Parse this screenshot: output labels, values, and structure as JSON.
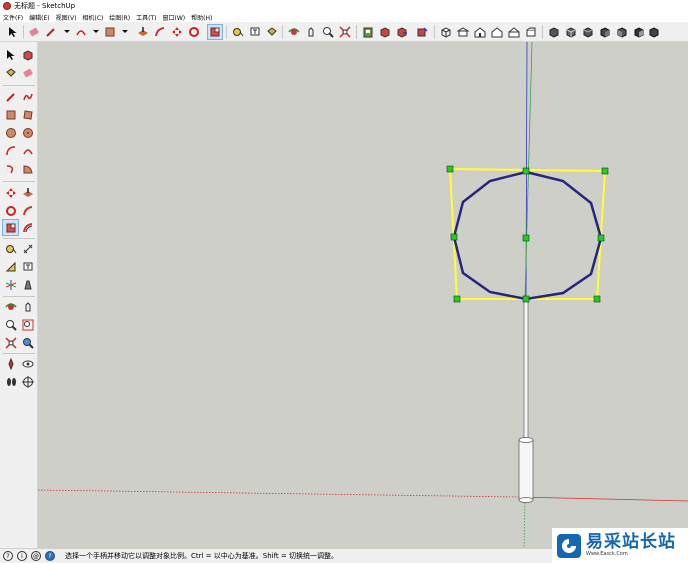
{
  "window": {
    "title": "无标题 - SketchUp"
  },
  "menu": [
    {
      "label": "文件(F)"
    },
    {
      "label": "编辑(E)"
    },
    {
      "label": "视图(V)"
    },
    {
      "label": "相机(C)"
    },
    {
      "label": "绘图(R)"
    },
    {
      "label": "工具(T)"
    },
    {
      "label": "窗口(W)"
    },
    {
      "label": "帮助(H)"
    }
  ],
  "toolbar": {
    "top_icons": [
      "select-icon",
      "eraser-icon",
      "pencil-icon",
      "arc-icon",
      "rectangle-icon",
      "push-pull-icon",
      "follow-me-icon",
      "move-icon",
      "rotate-icon",
      "scale-icon",
      "tape-measure-icon",
      "text-icon",
      "paint-bucket-icon",
      "orbit-icon",
      "pan-icon",
      "zoom-icon",
      "zoom-extents-icon",
      "warehouse-icon",
      "extension-icon",
      "share-model-icon",
      "iso-view-icon",
      "top-view-icon",
      "front-view-icon",
      "right-view-icon",
      "back-view-icon",
      "left-view-icon",
      "xray-icon",
      "wireframe-icon",
      "hidden-line-icon",
      "shaded-icon",
      "textured-icon"
    ],
    "left_icons": [
      "select-icon",
      "make-component-icon",
      "paint-bucket-icon",
      "eraser-icon",
      "line-icon",
      "freehand-icon",
      "rectangle-icon",
      "rotated-rectangle-icon",
      "circle-icon",
      "polygon-icon",
      "arc-icon",
      "pie-icon",
      "move-icon",
      "push-pull-icon",
      "rotate-icon",
      "follow-me-icon",
      "scale-icon",
      "offset-icon",
      "tape-measure-icon",
      "dimension-icon",
      "protractor-icon",
      "text-icon",
      "axes-icon",
      "3d-text-icon",
      "orbit-icon",
      "pan-icon",
      "zoom-icon",
      "zoom-window-icon",
      "zoom-extents-icon",
      "previous-view-icon",
      "position-camera-icon",
      "look-around-icon",
      "walk-icon",
      "section-plane-icon"
    ]
  },
  "status": {
    "message": "选择一个手柄并移动它以调整对象比例。Ctrl = 以中心为基准。Shift = 切换统一调整。"
  },
  "watermark": {
    "name": "易采站长站",
    "url": "Www.Easck.Com"
  },
  "colors": {
    "viewport_bg": "#cfcfca",
    "circle_edge": "#26267a",
    "scale_box": "#ffff33",
    "grip": "#22cc22",
    "axis_red": "#cc3333",
    "axis_green": "#33aa33",
    "axis_blue": "#3333cc"
  }
}
